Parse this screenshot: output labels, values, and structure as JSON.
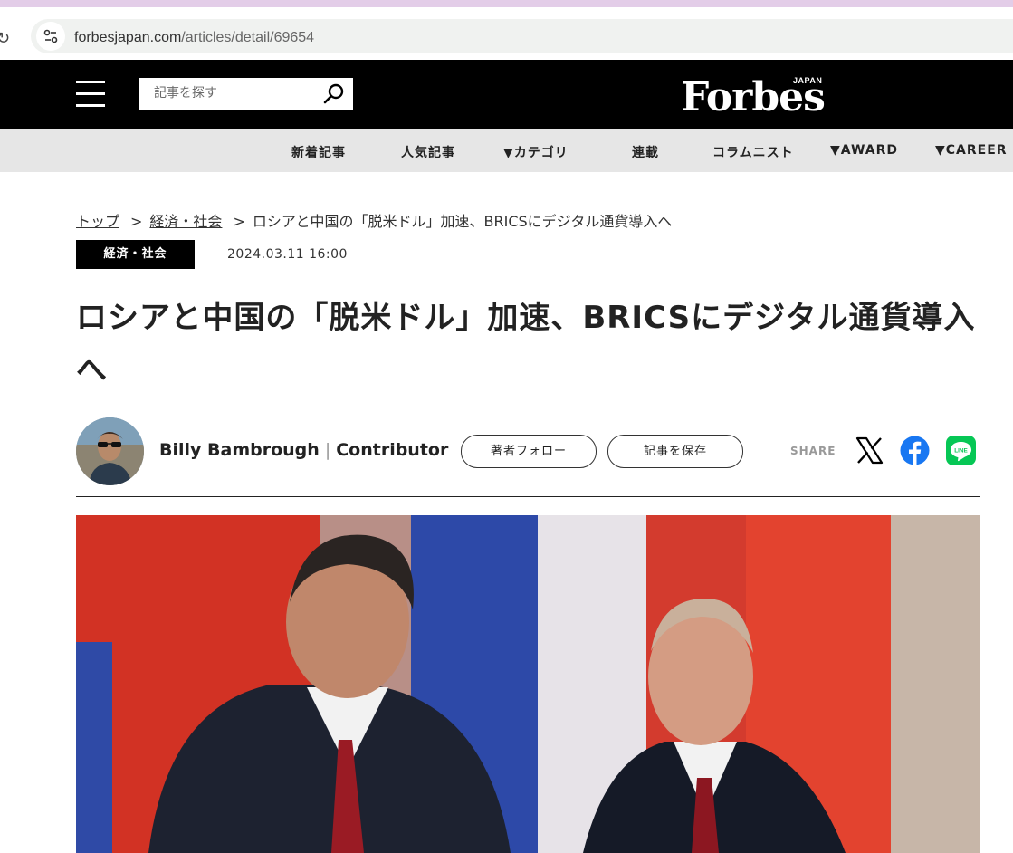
{
  "browser": {
    "url_domain": "forbesjapan.com",
    "url_path": "/articles/detail/69654"
  },
  "header": {
    "search_placeholder": "記事を探す",
    "logo": "Forbes",
    "logo_sub": "JAPAN"
  },
  "nav": {
    "items": [
      "新着記事",
      "人気記事",
      "▼カテゴリ",
      "連載",
      "コラムニスト",
      "▼AWARD",
      "▼CAREER"
    ]
  },
  "breadcrumb": {
    "items": [
      "トップ",
      "経済・社会",
      "ロシアと中国の「脱米ドル」加速、BRICSにデジタル通貨導入へ"
    ],
    "separator": ">"
  },
  "article": {
    "category": "経済・社会",
    "date": "2024.03.11 16:00",
    "title": "ロシアと中国の「脱米ドル」加速、BRICSにデジタル通貨導入へ",
    "author_name": "Billy Bambrough",
    "author_role": "Contributor",
    "follow_label": "著者フォロー",
    "save_label": "記事を保存",
    "share_label": "SHARE"
  },
  "colors": {
    "header_bg": "#000000",
    "nav_bg": "#e6e6e6",
    "facebook": "#1877f2",
    "line": "#06c755"
  }
}
